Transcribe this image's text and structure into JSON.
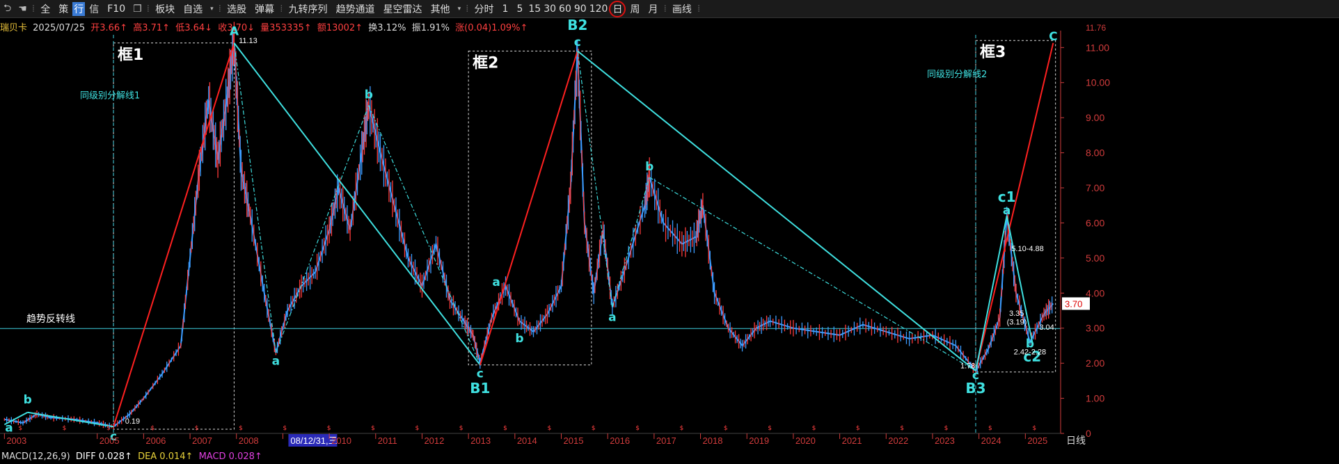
{
  "toolbar": {
    "items": [
      "全",
      "策",
      "行",
      "信",
      "F10",
      "板块",
      "自选",
      "选股",
      "弹幕",
      "九转序列",
      "趋势通道",
      "星空雷达",
      "其他",
      "分时",
      "1",
      "5",
      "15",
      "30",
      "60",
      "90",
      "120",
      "日",
      "周",
      "月",
      "画线"
    ]
  },
  "info": {
    "name": "瑞贝卡",
    "date": "2025/07/25",
    "open": "开3.66↑",
    "high": "高3.71↑",
    "low": "低3.64↓",
    "close": "收3.70↓",
    "volume": "量353335↑",
    "amount": "额13002↑",
    "turnover": "换3.12%",
    "amplitude": "振1.91%",
    "change": "涨(0.04)1.09%↑"
  },
  "macd": {
    "label": "MACD(12,26,9)",
    "diff": "DIFF 0.028↑",
    "dea": "DEA 0.014↑",
    "macd": "MACD 0.028↑"
  },
  "colors": {
    "up": "#ff3b3b",
    "down": "#3c9cff",
    "cyan": "#3fe0e0",
    "red": "#ff2020",
    "white": "#ffffff",
    "axis": "#d23c3c",
    "magenta": "#e040e0"
  },
  "chart_data": {
    "type": "line",
    "y_ticks": [
      "0",
      "1.00",
      "2.00",
      "3.00",
      "4.00",
      "5.00",
      "6.00",
      "7.00",
      "8.00",
      "9.00",
      "10.00",
      "11.00"
    ],
    "ylim": [
      0,
      11.76
    ],
    "top_label": "11.76",
    "current_price": "3.70",
    "x_labels": [
      "2003",
      "2005",
      "2006",
      "2007",
      "2008",
      "08/12/31,三",
      "2010",
      "2011",
      "2012",
      "2013",
      "2014",
      "2015",
      "2016",
      "2017",
      "2018",
      "2019",
      "2020",
      "2021",
      "2022",
      "2023",
      "2024",
      "2025"
    ],
    "x_label_years": [
      2003.0,
      2005.0,
      2006.0,
      2007.0,
      2008.0,
      2009.0,
      2010.0,
      2011.0,
      2012.0,
      2013.0,
      2014.0,
      2015.0,
      2016.0,
      2017.0,
      2018.0,
      2019.0,
      2020.0,
      2021.0,
      2022.0,
      2023.0,
      2024.0,
      2025.0
    ],
    "xlim": [
      2002.95,
      2025.7
    ],
    "axis_end_label": "日线",
    "price_series": [
      [
        2003.0,
        0.4
      ],
      [
        2003.4,
        0.3
      ],
      [
        2003.7,
        0.55
      ],
      [
        2004.0,
        0.45
      ],
      [
        2004.5,
        0.4
      ],
      [
        2005.0,
        0.3
      ],
      [
        2005.35,
        0.19
      ],
      [
        2005.7,
        0.55
      ],
      [
        2006.0,
        1.0
      ],
      [
        2006.4,
        1.7
      ],
      [
        2006.8,
        2.5
      ],
      [
        2007.0,
        5.0
      ],
      [
        2007.2,
        7.5
      ],
      [
        2007.4,
        9.5
      ],
      [
        2007.6,
        7.8
      ],
      [
        2007.8,
        9.6
      ],
      [
        2007.95,
        11.13
      ],
      [
        2008.1,
        7.5
      ],
      [
        2008.3,
        6.2
      ],
      [
        2008.6,
        4.0
      ],
      [
        2008.85,
        2.3
      ],
      [
        2009.1,
        3.5
      ],
      [
        2009.4,
        4.2
      ],
      [
        2009.7,
        4.6
      ],
      [
        2010.0,
        5.8
      ],
      [
        2010.2,
        7.0
      ],
      [
        2010.45,
        5.8
      ],
      [
        2010.7,
        8.0
      ],
      [
        2010.85,
        9.35
      ],
      [
        2011.1,
        8.0
      ],
      [
        2011.4,
        6.5
      ],
      [
        2011.7,
        5.0
      ],
      [
        2012.0,
        4.2
      ],
      [
        2012.3,
        5.4
      ],
      [
        2012.6,
        3.8
      ],
      [
        2012.9,
        3.2
      ],
      [
        2013.1,
        2.8
      ],
      [
        2013.25,
        2.0
      ],
      [
        2013.5,
        3.3
      ],
      [
        2013.8,
        4.2
      ],
      [
        2014.1,
        3.2
      ],
      [
        2014.4,
        2.9
      ],
      [
        2014.7,
        3.4
      ],
      [
        2015.0,
        4.2
      ],
      [
        2015.2,
        7.0
      ],
      [
        2015.35,
        10.9
      ],
      [
        2015.5,
        6.0
      ],
      [
        2015.7,
        4.0
      ],
      [
        2015.9,
        5.8
      ],
      [
        2016.1,
        3.6
      ],
      [
        2016.4,
        4.8
      ],
      [
        2016.8,
        6.5
      ],
      [
        2016.9,
        7.3
      ],
      [
        2017.2,
        6.0
      ],
      [
        2017.6,
        5.4
      ],
      [
        2017.9,
        5.6
      ],
      [
        2018.05,
        6.5
      ],
      [
        2018.3,
        4.0
      ],
      [
        2018.6,
        3.0
      ],
      [
        2018.9,
        2.5
      ],
      [
        2019.2,
        3.0
      ],
      [
        2019.5,
        3.2
      ],
      [
        2020.0,
        3.0
      ],
      [
        2020.5,
        2.9
      ],
      [
        2021.0,
        2.8
      ],
      [
        2021.5,
        3.1
      ],
      [
        2022.0,
        2.9
      ],
      [
        2022.5,
        2.7
      ],
      [
        2023.0,
        2.8
      ],
      [
        2023.5,
        2.5
      ],
      [
        2023.93,
        1.78
      ],
      [
        2024.2,
        2.4
      ],
      [
        2024.45,
        3.3
      ],
      [
        2024.6,
        6.2
      ],
      [
        2024.8,
        4.0
      ],
      [
        2025.1,
        2.6
      ],
      [
        2025.4,
        3.4
      ],
      [
        2025.6,
        3.7
      ]
    ],
    "waves": [
      {
        "from": [
          2005.35,
          0.19
        ],
        "to": [
          2007.95,
          11.13
        ],
        "color": "#ff2020"
      },
      {
        "from": [
          2007.95,
          11.13
        ],
        "to": [
          2013.25,
          1.95
        ],
        "color": "#3fe0e0"
      },
      {
        "from": [
          2013.25,
          1.95
        ],
        "to": [
          2015.35,
          10.9
        ],
        "color": "#ff2020"
      },
      {
        "from": [
          2015.35,
          10.9
        ],
        "to": [
          2023.93,
          1.78
        ],
        "color": "#3fe0e0"
      },
      {
        "from": [
          2023.93,
          1.78
        ],
        "to": [
          2025.6,
          11.13
        ],
        "color": "#ff2020"
      },
      {
        "from": [
          2003.0,
          0.25
        ],
        "to": [
          2003.5,
          0.6
        ],
        "color": "#3fe0e0"
      },
      {
        "from": [
          2003.5,
          0.6
        ],
        "to": [
          2005.35,
          0.19
        ],
        "color": "#3fe0e0"
      },
      {
        "from": [
          2007.95,
          11.13
        ],
        "to": [
          2008.85,
          2.3
        ],
        "color": "#3fe0e0",
        "dash": true
      },
      {
        "from": [
          2008.85,
          2.3
        ],
        "to": [
          2010.85,
          9.35
        ],
        "color": "#3fe0e0",
        "dash": true
      },
      {
        "from": [
          2010.85,
          9.35
        ],
        "to": [
          2013.25,
          1.95
        ],
        "color": "#3fe0e0",
        "dash": true
      },
      {
        "from": [
          2015.35,
          10.9
        ],
        "to": [
          2016.1,
          3.6
        ],
        "color": "#3fe0e0",
        "dash": true
      },
      {
        "from": [
          2016.1,
          3.6
        ],
        "to": [
          2016.9,
          7.3
        ],
        "color": "#3fe0e0",
        "dash": true
      },
      {
        "from": [
          2016.9,
          7.3
        ],
        "to": [
          2023.93,
          1.78
        ],
        "color": "#3fe0e0",
        "dash": true
      },
      {
        "from": [
          2023.93,
          1.78
        ],
        "to": [
          2024.6,
          6.2
        ],
        "color": "#3fe0e0"
      },
      {
        "from": [
          2024.6,
          6.2
        ],
        "to": [
          2025.15,
          2.6
        ],
        "color": "#3fe0e0"
      }
    ],
    "hline": {
      "y": 2.99,
      "label": "趋势反转线"
    },
    "vlines": [
      {
        "x": 2005.35,
        "label": "同级别分解线1",
        "label_y": 9.55
      },
      {
        "x": 2023.93,
        "label": "同级别分解线2",
        "label_y": 10.15
      }
    ],
    "frames": [
      {
        "x0": 2005.35,
        "x1": 2007.95,
        "y0": 0.12,
        "y1": 11.13,
        "label": "框1"
      },
      {
        "x0": 2013.0,
        "x1": 2015.65,
        "y0": 1.95,
        "y1": 10.9,
        "label": "框2"
      },
      {
        "x0": 2023.93,
        "x1": 2025.65,
        "y0": 1.75,
        "y1": 11.2,
        "label": "框3"
      }
    ],
    "wave_labels": [
      {
        "text": "a",
        "x": 2003.1,
        "y": 0.05
      },
      {
        "text": "b",
        "x": 2003.5,
        "y": 0.85
      },
      {
        "text": "c",
        "x": 2005.35,
        "y": -0.2
      },
      {
        "text": "A",
        "x": 2007.95,
        "y": 11.35
      },
      {
        "text": "a",
        "x": 2008.85,
        "y": 1.95
      },
      {
        "text": "b",
        "x": 2010.85,
        "y": 9.55
      },
      {
        "text": "c",
        "x": 2013.25,
        "y": 1.6
      },
      {
        "text": "B1",
        "x": 2013.25,
        "y": 1.15
      },
      {
        "text": "a",
        "x": 2013.6,
        "y": 4.2
      },
      {
        "text": "b",
        "x": 2014.1,
        "y": 2.6
      },
      {
        "text": "B2",
        "x": 2015.35,
        "y": 11.5
      },
      {
        "text": "c",
        "x": 2015.35,
        "y": 11.05
      },
      {
        "text": "a",
        "x": 2016.1,
        "y": 3.2
      },
      {
        "text": "b",
        "x": 2016.9,
        "y": 7.5
      },
      {
        "text": "C",
        "x": 2025.6,
        "y": 11.2
      },
      {
        "text": "c1",
        "x": 2024.6,
        "y": 6.6
      },
      {
        "text": "a",
        "x": 2024.6,
        "y": 6.25
      },
      {
        "text": "b",
        "x": 2025.1,
        "y": 2.45
      },
      {
        "text": "c2",
        "x": 2025.15,
        "y": 2.05
      },
      {
        "text": "B3",
        "x": 2023.93,
        "y": 1.15
      },
      {
        "text": "c",
        "x": 2023.93,
        "y": 1.55
      }
    ],
    "price_labels": [
      {
        "text": "11.13",
        "x": 2008.05,
        "y": 11.13
      },
      {
        "text": "0.19",
        "x": 2005.6,
        "y": 0.28
      },
      {
        "text": "1.78",
        "x": 2023.6,
        "y": 1.85
      },
      {
        "text": "5.10-4.88",
        "x": 2024.7,
        "y": 5.2
      },
      {
        "text": "3.35",
        "x": 2024.65,
        "y": 3.35
      },
      {
        "text": "(3.19)",
        "x": 2024.6,
        "y": 3.1
      },
      {
        "text": "3.04",
        "x": 2025.3,
        "y": 2.95
      },
      {
        "text": "2.42-2.28",
        "x": 2024.75,
        "y": 2.25
      }
    ]
  }
}
